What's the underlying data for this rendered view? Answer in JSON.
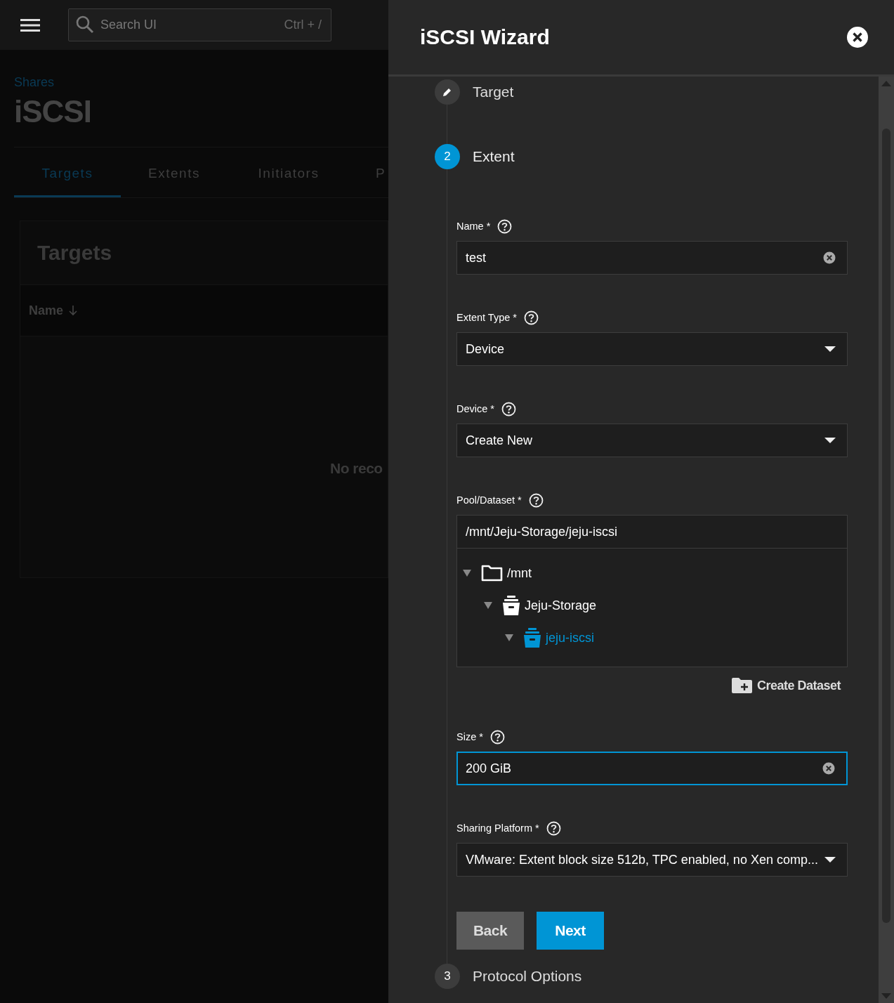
{
  "topbar": {
    "search": {
      "placeholder": "Search UI",
      "shortcut": "Ctrl + /"
    }
  },
  "page": {
    "breadcrumb": "Shares",
    "title": "iSCSI",
    "tabs": [
      {
        "label": "Targets",
        "selected": true
      },
      {
        "label": "Extents",
        "selected": false
      },
      {
        "label": "Initiators",
        "selected": false
      },
      {
        "label": "P",
        "selected": false
      }
    ],
    "card": {
      "title": "Targets",
      "column": "Name",
      "empty": "No reco"
    }
  },
  "wizard": {
    "title": "iSCSI Wizard",
    "steps": [
      {
        "label": "Target",
        "completed": true,
        "selected": false
      },
      {
        "number": "2",
        "label": "Extent",
        "completed": false,
        "selected": true
      },
      {
        "number": "3",
        "label": "Protocol Options",
        "completed": false,
        "selected": false
      }
    ],
    "fields": [
      {
        "kind": "text",
        "label": "Name *",
        "value": "test",
        "focused": false
      },
      {
        "kind": "select",
        "label": "Extent Type *",
        "value": "Device",
        "focused": false
      },
      {
        "kind": "select",
        "label": "Device *",
        "value": "Create New",
        "focused": false
      },
      {
        "kind": "path",
        "label": "Pool/Dataset *",
        "value": "/mnt/Jeju-Storage/jeju-iscsi",
        "focused": false
      },
      {
        "kind": "text",
        "label": "Size *",
        "value": "200 GiB",
        "focused": true
      },
      {
        "kind": "select",
        "label": "Sharing Platform *",
        "value": "VMware: Extent block size 512b, TPC enabled, no Xen comp...",
        "focused": false
      }
    ],
    "tree": [
      {
        "label": "/mnt",
        "kind": "folder",
        "expanded": true,
        "selected": false,
        "children": [
          {
            "label": "Jeju-Storage",
            "kind": "dataset",
            "expanded": true,
            "selected": false,
            "children": [
              {
                "label": "jeju-iscsi",
                "kind": "dataset",
                "expanded": true,
                "selected": true
              }
            ]
          }
        ]
      }
    ],
    "create_dataset": "Create Dataset",
    "buttons": [
      {
        "label": "Back",
        "kind": "secondary"
      },
      {
        "label": "Next",
        "kind": "primary"
      }
    ]
  }
}
